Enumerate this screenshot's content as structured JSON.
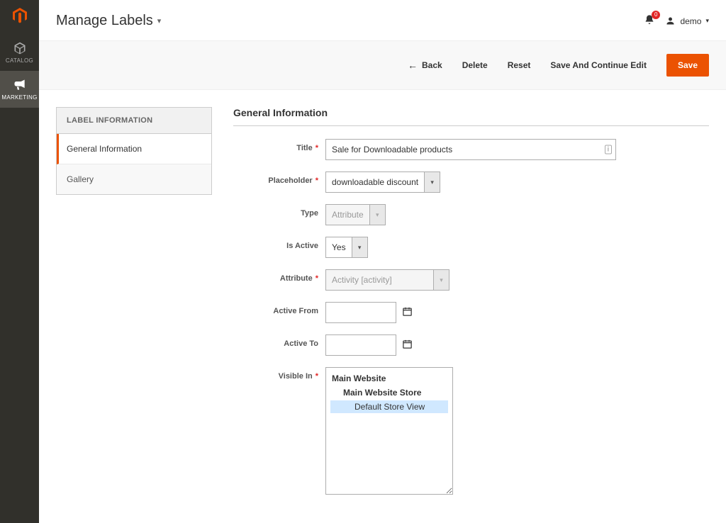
{
  "nav": {
    "catalog": "CATALOG",
    "marketing": "MARKETING"
  },
  "header": {
    "page_title": "Manage Labels",
    "notification_count": "0",
    "username": "demo"
  },
  "actions": {
    "back": "Back",
    "delete": "Delete",
    "reset": "Reset",
    "save_continue": "Save And Continue Edit",
    "save": "Save"
  },
  "tabs": {
    "header": "LABEL INFORMATION",
    "general": "General Information",
    "gallery": "Gallery"
  },
  "section": {
    "title": "General Information"
  },
  "form": {
    "title": {
      "label": "Title",
      "value": "Sale for Downloadable products"
    },
    "placeholder": {
      "label": "Placeholder",
      "value": "downloadable discount"
    },
    "type": {
      "label": "Type",
      "value": "Attribute"
    },
    "is_active": {
      "label": "Is Active",
      "value": "Yes"
    },
    "attribute": {
      "label": "Attribute",
      "value": "Activity [activity]"
    },
    "active_from": {
      "label": "Active From",
      "value": ""
    },
    "active_to": {
      "label": "Active To",
      "value": ""
    },
    "visible_in": {
      "label": "Visible In"
    }
  },
  "visible_tree": {
    "l1": "Main Website",
    "l2": "Main Website Store",
    "l3": "Default Store View"
  }
}
